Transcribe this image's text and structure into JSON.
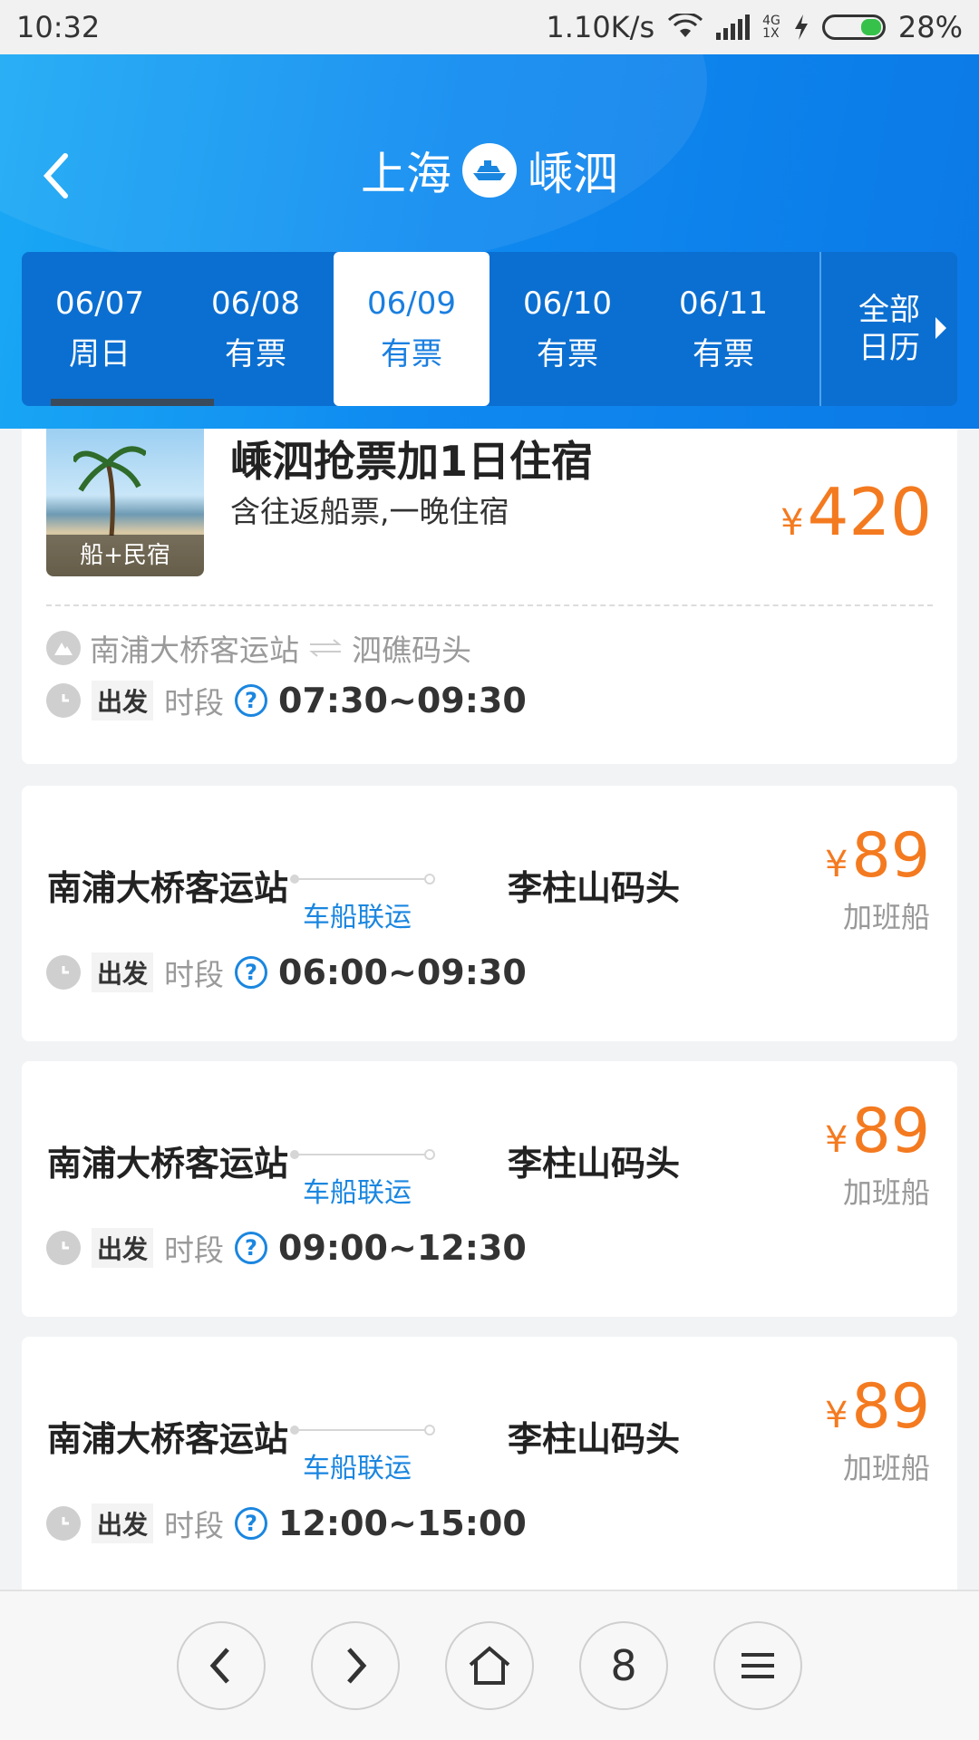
{
  "status_bar": {
    "time": "10:32",
    "speed": "1.10K/s",
    "net_top": "4G",
    "net_bottom": "1X",
    "battery": "28%",
    "battery_level": 0.28
  },
  "header": {
    "from": "上海",
    "to": "嵊泗"
  },
  "dates": [
    {
      "date": "06/07",
      "status": "周日"
    },
    {
      "date": "06/08",
      "status": "有票"
    },
    {
      "date": "06/09",
      "status": "有票"
    },
    {
      "date": "06/10",
      "status": "有票"
    },
    {
      "date": "06/11",
      "status": "有票"
    }
  ],
  "calendar": {
    "line1": "全部",
    "line2": "日历"
  },
  "package": {
    "image_caption": "船+民宿",
    "title": "嵊泗抢票加1日住宿",
    "subtitle": "含往返船票,一晚住宿",
    "currency": "¥",
    "price": "420",
    "from": "南浦大桥客运站",
    "to": "泗礁码头",
    "depart_label": "出发",
    "period_label": "时段",
    "time": "07:30~09:30"
  },
  "trips": [
    {
      "from": "南浦大桥客运站",
      "to": "李柱山码头",
      "link": "车船联运",
      "currency": "¥",
      "price": "89",
      "extra": "加班船",
      "depart_label": "出发",
      "period_label": "时段",
      "time": "06:00~09:30"
    },
    {
      "from": "南浦大桥客运站",
      "to": "李柱山码头",
      "link": "车船联运",
      "currency": "¥",
      "price": "89",
      "extra": "加班船",
      "depart_label": "出发",
      "period_label": "时段",
      "time": "09:00~12:30"
    },
    {
      "from": "南浦大桥客运站",
      "to": "李柱山码头",
      "link": "车船联运",
      "currency": "¥",
      "price": "89",
      "extra": "加班船",
      "depart_label": "出发",
      "period_label": "时段",
      "time": "12:00~15:00"
    }
  ],
  "bottom_nav": {
    "tabs_count": "8"
  },
  "colors": {
    "header_blue": "#0f8af0",
    "price_orange": "#f47a20",
    "link_blue": "#1a86e0"
  }
}
